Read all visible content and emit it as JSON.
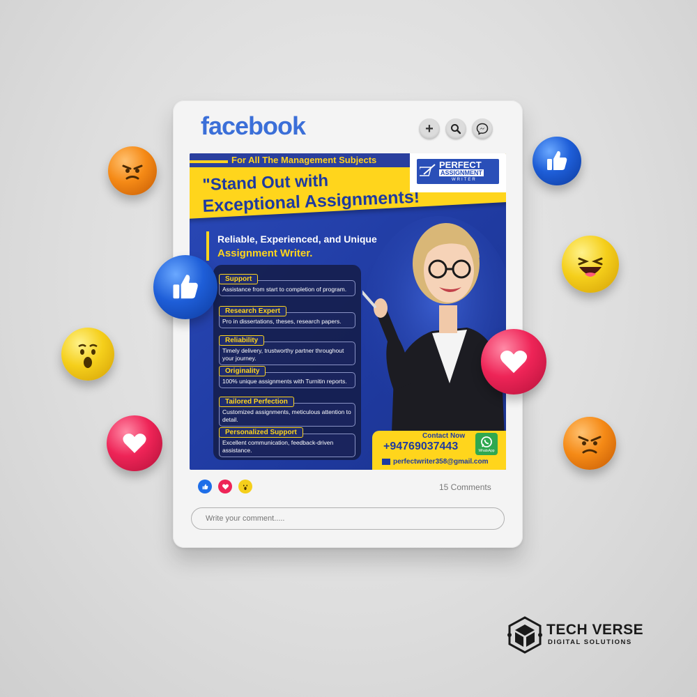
{
  "header": {
    "app_name": "facebook",
    "buttons": [
      {
        "name": "create",
        "icon": "plus-icon",
        "glyph": "+"
      },
      {
        "name": "search",
        "icon": "search-icon"
      },
      {
        "name": "messenger",
        "icon": "messenger-icon"
      }
    ]
  },
  "post": {
    "top_ribbon": "For All The Management Subjects",
    "headline_line1": "\"Stand Out with",
    "headline_line2": "Exceptional Assignments!",
    "logo": {
      "line1": "PERFECT",
      "line2": "ASSIGNMENT",
      "line3": "WRITER"
    },
    "subhead_line1": "Reliable, Experienced, and Unique",
    "subhead_line2": "Assignment Writer.",
    "features": [
      {
        "title": "Support",
        "text": "Assistance from start to completion of program."
      },
      {
        "title": "Research Expert",
        "text": "Pro in dissertations, theses, research papers."
      },
      {
        "title": "Reliability",
        "text": "Timely delivery, trustworthy partner throughout your journey."
      },
      {
        "title": "Originality",
        "text": "100% unique assignments with Turnitin reports."
      },
      {
        "title": "Tailored Perfection",
        "text": "Customized assignments, meticulous attention to detail."
      },
      {
        "title": "Personalized Support",
        "text": "Excellent communication, feedback-driven assistance."
      }
    ],
    "contact": {
      "label": "Contact Now",
      "phone": "+94769037443",
      "email": "perfectwriter358@gmail.com",
      "whatsapp_label": "WhatsApp"
    }
  },
  "footer": {
    "reactions": [
      "like-icon",
      "love-icon",
      "wow-icon"
    ],
    "comments_count": "15 Comments",
    "comment_placeholder": "Write your comment....."
  },
  "brand": {
    "name": "TECH VERSE",
    "tagline": "DIGITAL SOLUTIONS"
  },
  "colors": {
    "facebook_blue": "#3b6fd8",
    "post_blue": "#2a49b8",
    "accent_yellow": "#ffd51c",
    "like_blue": "#1e5ed8",
    "love_red": "#ee2457"
  }
}
